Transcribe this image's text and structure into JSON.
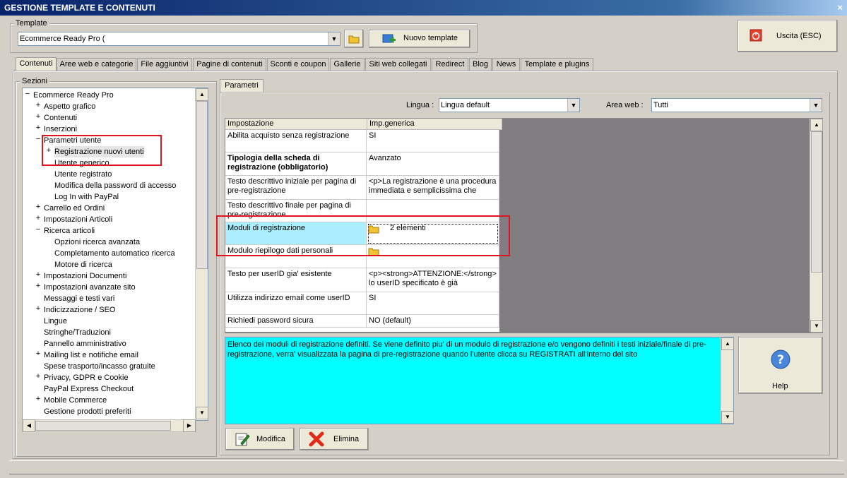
{
  "window": {
    "title": "GESTIONE TEMPLATE E CONTENUTI",
    "close_glyph": "×"
  },
  "template_group": {
    "label": "Template",
    "selected": "Ecommerce Ready Pro (",
    "new_template_label": "Nuovo template"
  },
  "exit_button": {
    "label": "Uscita (ESC)"
  },
  "tabs": [
    "Contenuti",
    "Aree web e categorie",
    "File aggiuntivi",
    "Pagine di contenuti",
    "Sconti e coupon",
    "Gallerie",
    "Siti web collegati",
    "Redirect",
    "Blog",
    "News",
    "Template e plugins"
  ],
  "sections": {
    "label": "Sezioni",
    "tree": [
      {
        "label": "Ecommerce Ready Pro",
        "exp": "−"
      },
      {
        "label": "Aspetto grafico",
        "exp": "+"
      },
      {
        "label": "Contenuti",
        "exp": "+"
      },
      {
        "label": "Inserzioni",
        "exp": "+"
      },
      {
        "label": "Parametri utente",
        "exp": "−"
      },
      {
        "label": "Registrazione nuovi utenti",
        "exp": "+"
      },
      {
        "label": "Utente generico",
        "exp": ""
      },
      {
        "label": "Utente registrato",
        "exp": ""
      },
      {
        "label": "Modifica della password di accesso",
        "exp": ""
      },
      {
        "label": "Log In with PayPal",
        "exp": ""
      },
      {
        "label": "Carrello ed Ordini",
        "exp": "+"
      },
      {
        "label": "Impostazioni Articoli",
        "exp": "+"
      },
      {
        "label": "Ricerca articoli",
        "exp": "−"
      },
      {
        "label": "Opzioni ricerca avanzata",
        "exp": ""
      },
      {
        "label": "Completamento automatico ricerca",
        "exp": ""
      },
      {
        "label": "Motore di ricerca",
        "exp": ""
      },
      {
        "label": "Impostazioni Documenti",
        "exp": "+"
      },
      {
        "label": "Impostazioni avanzate sito",
        "exp": "+"
      },
      {
        "label": "Messaggi e testi vari",
        "exp": ""
      },
      {
        "label": "Indicizzazione / SEO",
        "exp": "+"
      },
      {
        "label": "Lingue",
        "exp": ""
      },
      {
        "label": "Stringhe/Traduzioni",
        "exp": ""
      },
      {
        "label": "Pannello amministrativo",
        "exp": ""
      },
      {
        "label": "Mailing list e notifiche email",
        "exp": "+"
      },
      {
        "label": "Spese trasporto/incasso gratuite",
        "exp": ""
      },
      {
        "label": "Privacy, GDPR e Cookie",
        "exp": "+"
      },
      {
        "label": "PayPal Express Checkout",
        "exp": ""
      },
      {
        "label": "Mobile Commerce",
        "exp": "+"
      },
      {
        "label": "Gestione prodotti preferiti",
        "exp": ""
      }
    ],
    "selected_index": 5
  },
  "params": {
    "tab_label": "Parametri",
    "lingua_label": "Lingua :",
    "lingua_value": "Lingua default",
    "area_label": "Area web :",
    "area_value": "Tutti",
    "headers": [
      "Impostazione",
      "Imp.generica"
    ],
    "rows": [
      {
        "name": "Abilita acquisto senza registrazione",
        "value": "SI"
      },
      {
        "name": "Tipologia della scheda di registrazione (obbligatorio)",
        "value": "Avanzato",
        "bold": true
      },
      {
        "name": "Testo descrittivo iniziale per pagina di pre-registrazione",
        "value": "<p>La registrazione è una procedura immediata e semplicissima che"
      },
      {
        "name": "Testo descrittivo finale per pagina di pre-registrazione",
        "value": ""
      },
      {
        "name": "Moduli di registrazione",
        "value": "2 elementi",
        "folder": true,
        "highlight": true
      },
      {
        "name": "Modulo riepilogo dati personali",
        "value": "",
        "folder": true
      },
      {
        "name": "Testo per userID gia' esistente",
        "value": "<p><strong>ATTENZIONE:</strong> lo userID specificato è già"
      },
      {
        "name": "Utilizza indirizzo email come userID",
        "value": "SI"
      },
      {
        "name": "Richiedi password sicura",
        "value": "NO (default)"
      }
    ]
  },
  "description": "Elenco dei moduli di registrazione definiti. Se viene definito piu' di un modulo di registrazione e/o vengono definiti i testi iniziale/finale di pre-registrazione, verra' visualizzata la pagina di pre-registrazione quando l'utente clicca su REGISTRATI all'interno del sito",
  "help_button": {
    "label": "Help"
  },
  "actions": {
    "modify": "Modifica",
    "delete": "Elimina"
  },
  "colors": {
    "title_bar": "#0a246a",
    "description_bg": "#00ffff",
    "highlight_cell": "#aaeeff",
    "callout_red": "#e0141e"
  }
}
